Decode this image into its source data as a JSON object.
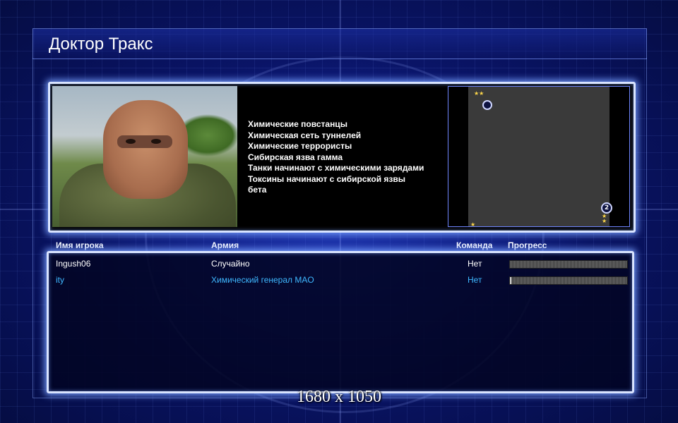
{
  "header": {
    "title": "Доктор Тракс"
  },
  "briefing": {
    "portrait_icon": "masked-general-portrait",
    "description_lines": [
      "Химические повстанцы",
      "Химическая сеть туннелей",
      "Химические террористы",
      "Сибирская язва гамма",
      "Танки начинают с химическими зарядами",
      "Токсины начинают с сибирской язвы",
      " бета"
    ],
    "minimap": {
      "base_2_label": "2",
      "star_top_left": "★★",
      "star_bottom_right": "★",
      "star_bottom_left": "★"
    }
  },
  "players": {
    "columns": {
      "name": "Имя игрока",
      "army": "Армия",
      "team": "Команда",
      "progress": "Прогресс"
    },
    "rows": [
      {
        "name": "Ingush06",
        "army": "Случайно",
        "team": "Нет",
        "progress": 0.0,
        "color": "#ffffff"
      },
      {
        "name": "ity",
        "army": "Химический генерал MAO",
        "team": "Нет",
        "progress": 0.01,
        "color": "#3fb8ff"
      }
    ]
  },
  "footer": {
    "resolution": "1680 x 1050"
  }
}
